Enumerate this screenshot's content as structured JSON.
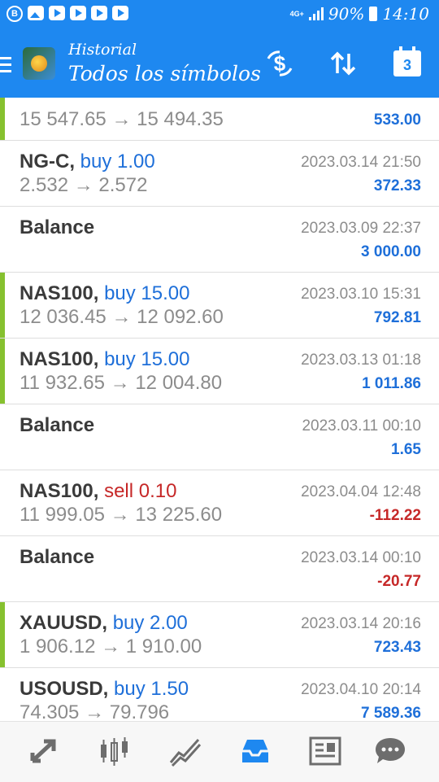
{
  "status_bar": {
    "time": "14:10",
    "battery": "90%",
    "network": "4G+"
  },
  "header": {
    "title": "Historial",
    "subtitle": "Todos los símbolos",
    "calendar_day": "3"
  },
  "rows": [
    {
      "symbol": "",
      "action": "",
      "type": "",
      "prices": "15 547.65 → 15 494.35",
      "datetime": "",
      "amount": "533.00",
      "sign": "pos",
      "accent": "green"
    },
    {
      "symbol": "NG-C, ",
      "action": "buy 1.00",
      "type": "buy",
      "prices": "2.532 → 2.572",
      "datetime": "2023.03.14 21:50",
      "amount": "372.33",
      "sign": "pos",
      "accent": "none"
    },
    {
      "symbol": "Balance",
      "action": "",
      "type": "",
      "prices": "",
      "datetime": "2023.03.09 22:37",
      "amount": "3 000.00",
      "sign": "pos",
      "accent": "none"
    },
    {
      "symbol": "NAS100, ",
      "action": "buy 15.00",
      "type": "buy",
      "prices": "12 036.45 → 12 092.60",
      "datetime": "2023.03.10 15:31",
      "amount": "792.81",
      "sign": "pos",
      "accent": "green"
    },
    {
      "symbol": "NAS100, ",
      "action": "buy 15.00",
      "type": "buy",
      "prices": "11 932.65 → 12 004.80",
      "datetime": "2023.03.13 01:18",
      "amount": "1 011.86",
      "sign": "pos",
      "accent": "green"
    },
    {
      "symbol": "Balance",
      "action": "",
      "type": "",
      "prices": "",
      "datetime": "2023.03.11 00:10",
      "amount": "1.65",
      "sign": "pos",
      "accent": "none"
    },
    {
      "symbol": "NAS100, ",
      "action": "sell 0.10",
      "type": "sell",
      "prices": "11 999.05 → 13 225.60",
      "datetime": "2023.04.04 12:48",
      "amount": "-112.22",
      "sign": "neg",
      "accent": "none"
    },
    {
      "symbol": "Balance",
      "action": "",
      "type": "",
      "prices": "",
      "datetime": "2023.03.14 00:10",
      "amount": "-20.77",
      "sign": "neg",
      "accent": "none"
    },
    {
      "symbol": "XAUUSD, ",
      "action": "buy 2.00",
      "type": "buy",
      "prices": "1 906.12 → 1 910.00",
      "datetime": "2023.03.14 20:16",
      "amount": "723.43",
      "sign": "pos",
      "accent": "green"
    },
    {
      "symbol": "USOUSD, ",
      "action": "buy 1.50",
      "type": "buy",
      "prices": "74.305 → 79.796",
      "datetime": "2023.04.10 20:14",
      "amount": "7 589.36",
      "sign": "pos",
      "accent": "none"
    }
  ],
  "nav": [
    "trade-arrows-icon",
    "candles-icon",
    "chart-icon",
    "history-inbox-icon",
    "news-icon",
    "chat-icon"
  ],
  "colors": {
    "primary": "#1e88f0",
    "buy": "#1e6fd9",
    "sell": "#c62828",
    "accent_bar": "#86c12f"
  }
}
